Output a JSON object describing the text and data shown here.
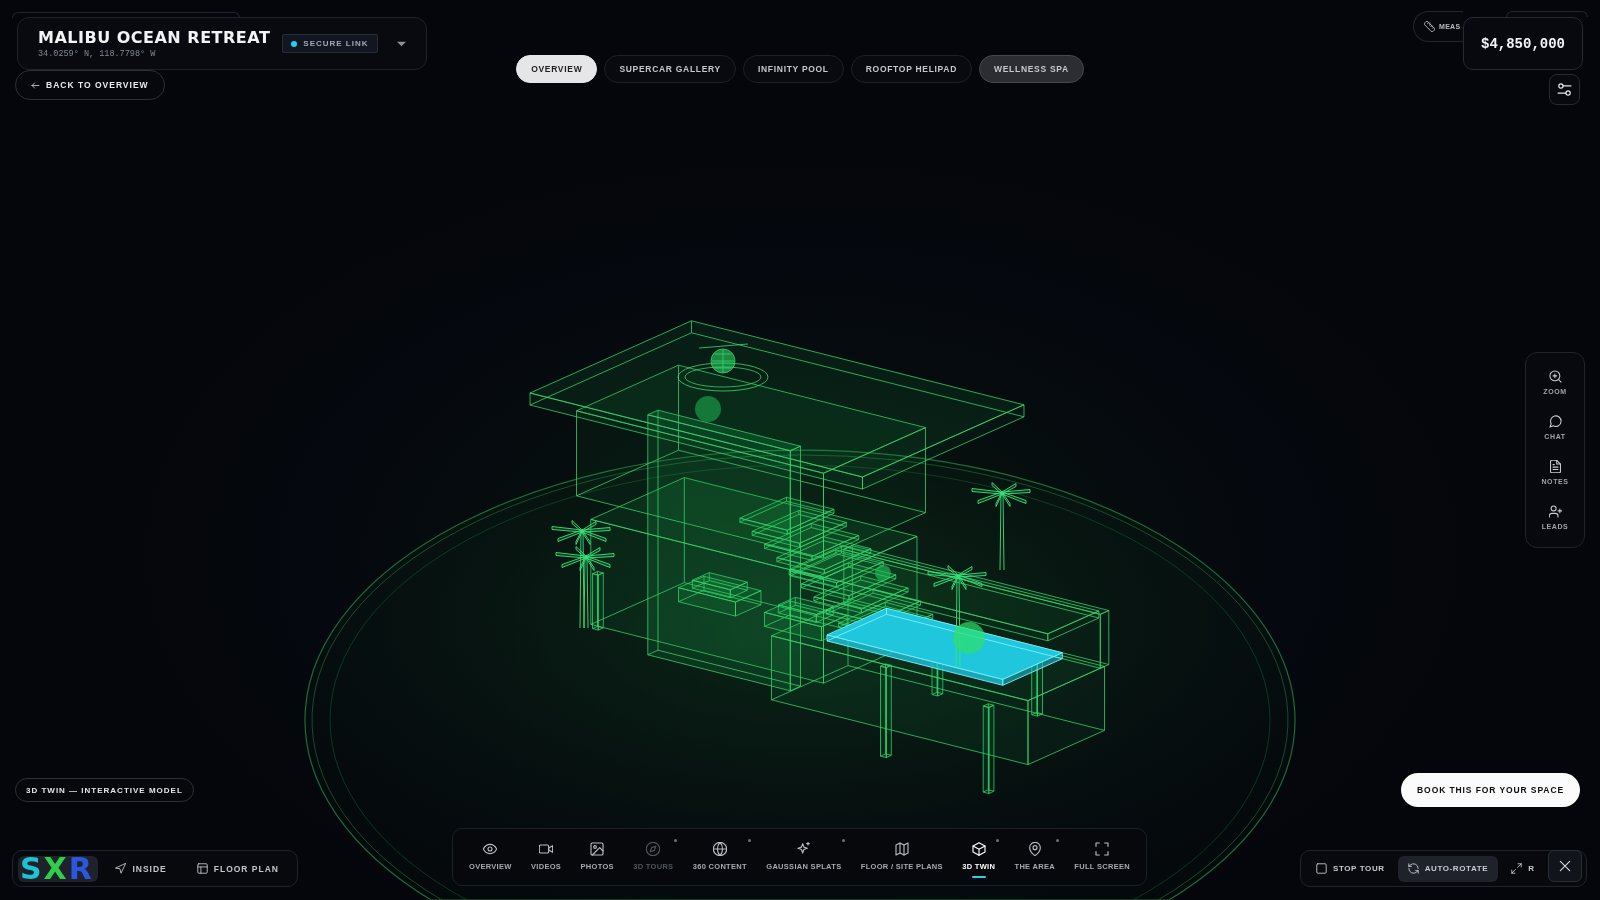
{
  "header": {
    "title": "MALIBU OCEAN RETREAT",
    "coordinates": "34.0259° N, 118.7798° W",
    "status": "SECURE LINK"
  },
  "back_button": {
    "label": "BACK TO OVERVIEW"
  },
  "tabs": [
    {
      "label": "OVERVIEW",
      "selected": true,
      "highlighted": false
    },
    {
      "label": "SUPERCAR GALLERY",
      "selected": false,
      "highlighted": false
    },
    {
      "label": "INFINITY POOL",
      "selected": false,
      "highlighted": false
    },
    {
      "label": "ROOFTOP HELIPAD",
      "selected": false,
      "highlighted": false
    },
    {
      "label": "WELLNESS SPA",
      "selected": false,
      "highlighted": true
    }
  ],
  "measure_button": {
    "label": "MEAS"
  },
  "price": "$4,850,000",
  "side_tools": [
    {
      "label": "ZOOM",
      "kind": "zoom"
    },
    {
      "label": "CHAT",
      "kind": "chat"
    },
    {
      "label": "NOTES",
      "kind": "notes"
    },
    {
      "label": "LEADS",
      "kind": "leads"
    }
  ],
  "model_label": "3D TWIN — INTERACTIVE MODEL",
  "view_modes": [
    {
      "kind": "dollhouse",
      "selected": true,
      "logo": "SXR"
    },
    {
      "label": "INSIDE",
      "kind": "inside",
      "selected": false
    },
    {
      "label": "FLOOR PLAN",
      "kind": "floorplan",
      "selected": false
    }
  ],
  "media_toolbar": [
    {
      "label": "OVERVIEW",
      "kind": "overview",
      "selected": false,
      "disabled": false,
      "dot": false
    },
    {
      "label": "VIDEOS",
      "kind": "videos",
      "selected": false,
      "disabled": false,
      "dot": false
    },
    {
      "label": "PHOTOS",
      "kind": "photos",
      "selected": false,
      "disabled": false,
      "dot": false
    },
    {
      "label": "3D TOURS",
      "kind": "tours",
      "selected": false,
      "disabled": true,
      "dot": true
    },
    {
      "label": "360 CONTENT",
      "kind": "panorama",
      "selected": false,
      "disabled": false,
      "dot": true
    },
    {
      "label": "GAUSSIAN SPLATS",
      "kind": "splats",
      "selected": false,
      "disabled": false,
      "dot": true
    },
    {
      "label": "FLOOR / SITE PLANS",
      "kind": "plans",
      "selected": false,
      "disabled": false,
      "dot": false
    },
    {
      "label": "3D TWIN",
      "kind": "twin",
      "selected": true,
      "disabled": false,
      "dot": true
    },
    {
      "label": "THE AREA",
      "kind": "area",
      "selected": false,
      "disabled": false,
      "dot": true
    },
    {
      "label": "FULL SCREEN",
      "kind": "fullscreen",
      "selected": false,
      "disabled": false,
      "dot": false
    }
  ],
  "book_button": {
    "label": "BOOK THIS FOR YOUR SPACE"
  },
  "tour_controls": [
    {
      "label": "STOP TOUR",
      "kind": "stop",
      "selected": false
    },
    {
      "label": "AUTO-ROTATE",
      "kind": "rotate",
      "selected": true
    },
    {
      "label": "R",
      "kind": "expand",
      "selected": false
    }
  ]
}
